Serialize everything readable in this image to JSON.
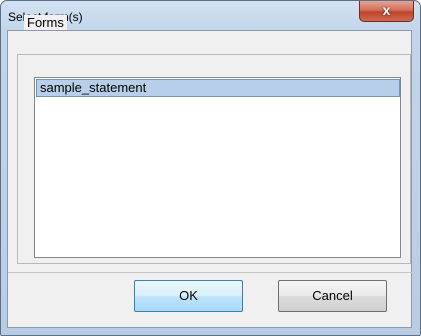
{
  "window": {
    "title": "Select form(s)",
    "close_glyph": "x"
  },
  "group": {
    "label": "Forms",
    "items": [
      {
        "label": "sample_statement",
        "selected": true
      }
    ]
  },
  "buttons": {
    "ok_label": "OK",
    "cancel_label": "Cancel"
  },
  "colors": {
    "selection": "#b8cfe9",
    "selection_border": "#7495bb",
    "close_button": "#c0432b"
  }
}
